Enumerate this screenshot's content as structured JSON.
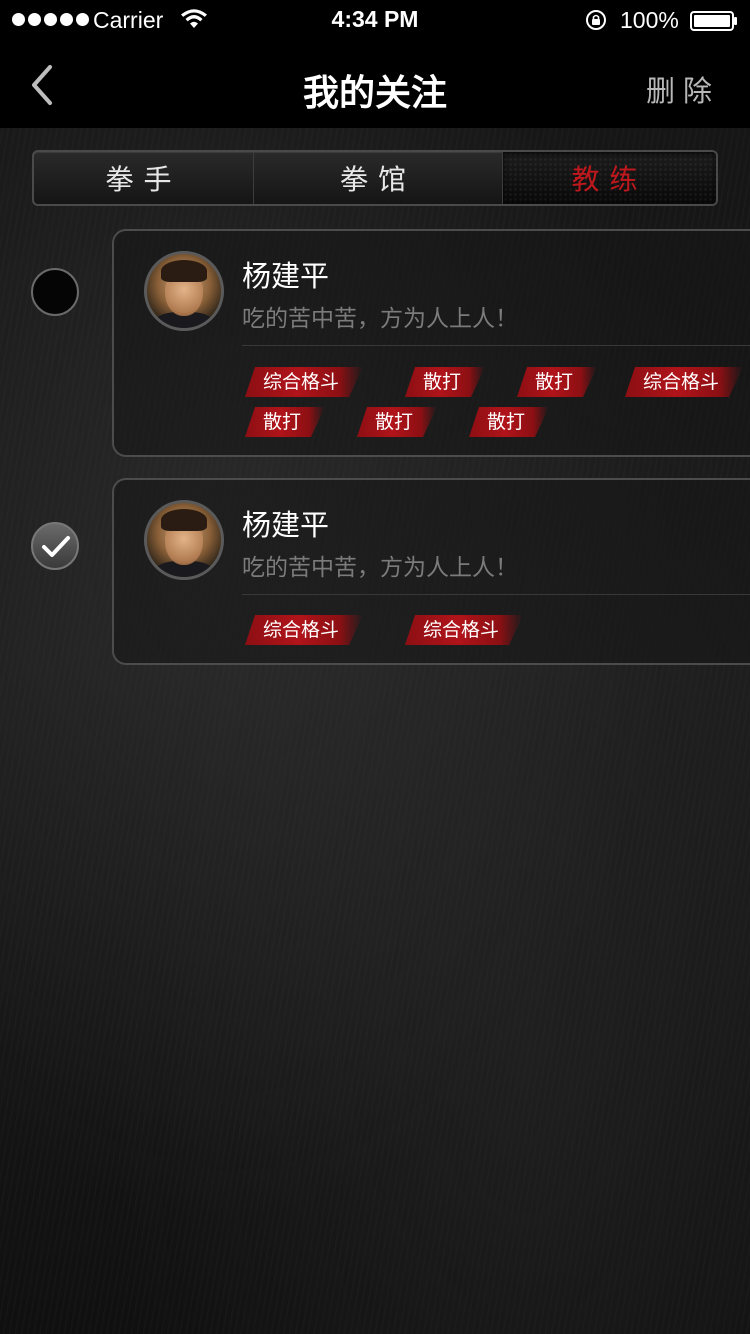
{
  "status_bar": {
    "carrier": "Carrier",
    "time": "4:34 PM",
    "battery": "100%",
    "signal_bars_filled": 5,
    "icons": [
      "signal-icon",
      "wifi-icon",
      "orientation-lock-icon",
      "battery-icon"
    ]
  },
  "nav": {
    "back_icon": "chevron-left-icon",
    "title": "我的关注",
    "action": "删除"
  },
  "tabs": {
    "items": [
      "拳手",
      "拳馆",
      "教练"
    ],
    "active_index": 2
  },
  "colors": {
    "accent_red": "#c0181c",
    "tag_red": "#b0141a",
    "muted_text": "#7b7b7b"
  },
  "coaches": [
    {
      "name": "杨建平",
      "motto": "吃的苦中苦，方为人上人！",
      "selected": false,
      "tags": [
        "综合格斗",
        "散打",
        "散打",
        "综合格斗",
        "散打",
        "散打",
        "散打"
      ]
    },
    {
      "name": "杨建平",
      "motto": "吃的苦中苦，方为人上人！",
      "selected": true,
      "tags": [
        "综合格斗",
        "综合格斗"
      ]
    }
  ]
}
